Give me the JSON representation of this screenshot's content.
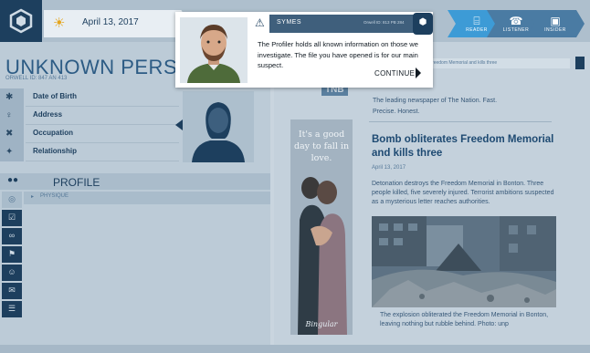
{
  "topbar": {
    "date": "April 13, 2017",
    "modes": [
      {
        "label": "READER",
        "icon": "open-book-icon",
        "glyph": "⌸"
      },
      {
        "label": "LISTENER",
        "icon": "headphones-icon",
        "glyph": "☎"
      },
      {
        "label": "INSIDER",
        "icon": "monitor-icon",
        "glyph": "▣"
      }
    ],
    "active_mode": "READER"
  },
  "profile": {
    "title": "UNKNOWN PERSON",
    "subtitle": "ORWELL ID: 847 AN 413",
    "fields": [
      {
        "label": "Date of Birth",
        "icon": "asterisk-icon",
        "glyph": "✱"
      },
      {
        "label": "Address",
        "icon": "location-icon",
        "glyph": "♀"
      },
      {
        "label": "Occupation",
        "icon": "tools-icon",
        "glyph": "✖"
      },
      {
        "label": "Relationship",
        "icon": "people-icon",
        "glyph": "✦"
      }
    ],
    "section_label": "PROFILE",
    "subsection_label": "PHYSIQUE",
    "side_icons": [
      {
        "name": "globe-icon",
        "glyph": "◎"
      },
      {
        "name": "checklist-icon",
        "glyph": "☑"
      },
      {
        "name": "link-icon",
        "glyph": "∞"
      },
      {
        "name": "flag-icon",
        "glyph": "⚑"
      },
      {
        "name": "person-icon",
        "glyph": "☺"
      },
      {
        "name": "chat-icon",
        "glyph": "✉"
      },
      {
        "name": "document-icon",
        "glyph": "☰"
      }
    ]
  },
  "newspaper": {
    "nav_text": "Freedom Memorial and kills three",
    "masthead": "TNB",
    "tagline": "The leading newspaper of The Nation. Fast. Precise. Honest.",
    "headline": "Bomb obliterates Freedom Memorial and kills three",
    "date": "April 13, 2017",
    "body": "Detonation destroys the Freedom Memorial in Bonton. Three people killed, five severely injured. Terrorist ambitions suspected as a mysterious letter reaches authorities.",
    "caption": "The explosion obliterated the Freedom Memorial in Bonton, leaving nothing but rubble behind. Photo: unp",
    "ad_text": "It's a good day to fall in love.",
    "ad_logo": "Bingular"
  },
  "dialog": {
    "name": "SYMES",
    "id_text": "Orwell ID: 813 PB 284",
    "message": "The Profiler holds all known information on those we investigate. The file you have opened is for our main suspect.",
    "continue_label": "CONTINUE"
  },
  "colors": {
    "navy": "#1d3f5e",
    "accent_blue": "#3d9bd6",
    "headline_blue": "#1e4a72",
    "dialog_header": "#3f5f7c"
  }
}
